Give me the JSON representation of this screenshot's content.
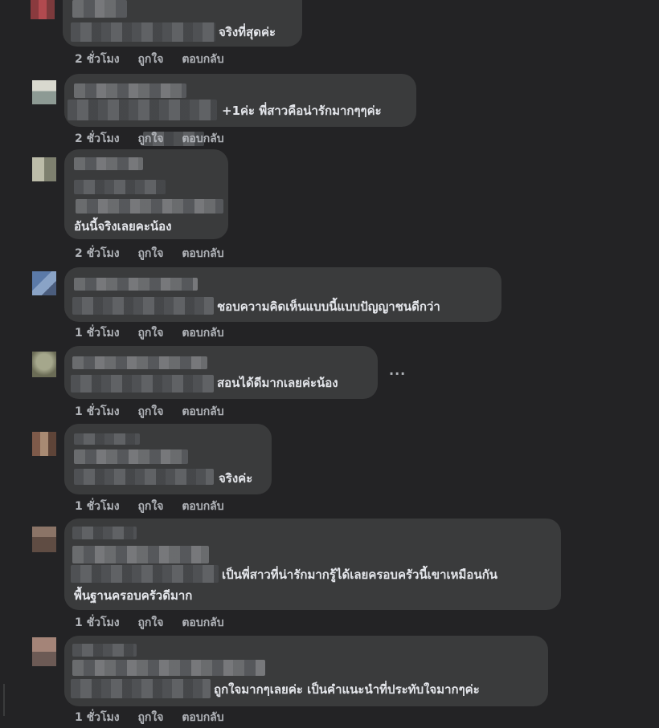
{
  "comments": [
    {
      "text": "จริงที่สุดค่ะ",
      "time": "2 ชั่วโมง",
      "like": "ถูกใจ",
      "reply": "ตอบกลับ"
    },
    {
      "text": "+1ค่ะ พี่สาวคือน่ารักมากๆๆค่ะ",
      "time": "2 ชั่วโมง",
      "like": "ถูกใจ",
      "reply": "ตอบกลับ"
    },
    {
      "text": "อันนี้จริงเลยคะน้อง",
      "time": "2 ชั่วโมง",
      "like": "ถูกใจ",
      "reply": "ตอบกลับ"
    },
    {
      "text": "ชอบความคิดเห็นแบบนี้แบบปัญญาชนดีกว่า",
      "time": "1 ชั่วโมง",
      "like": "ถูกใจ",
      "reply": "ตอบกลับ"
    },
    {
      "text": "สอนได้ดีมากเลยค่ะน้อง",
      "time": "1 ชั่วโมง",
      "like": "ถูกใจ",
      "reply": "ตอบกลับ",
      "more": "..."
    },
    {
      "text": "จริงค่ะ",
      "time": "1 ชั่วโมง",
      "like": "ถูกใจ",
      "reply": "ตอบกลับ"
    },
    {
      "text": "เป็นพี่สาวที่น่ารักมากรู้ได้เลยครอบครัวนี้เขาเหมือนกัน",
      "text2": "พื้นฐานครอบครัวดีมาก",
      "time": "1 ชั่วโมง",
      "like": "ถูกใจ",
      "reply": "ตอบกลับ"
    },
    {
      "text": "ถูกใจมากๆเลยค่ะ เป็นคำแนะนำที่ประทับใจมากๆค่ะ",
      "time": "1 ชั่วโมง",
      "like": "ถูกใจ",
      "reply": "ตอบกลับ"
    }
  ],
  "colors": {
    "background": "#232325",
    "bubble": "#3a3b3c",
    "text": "#e4e6eb",
    "meta": "#b0b3b8"
  }
}
